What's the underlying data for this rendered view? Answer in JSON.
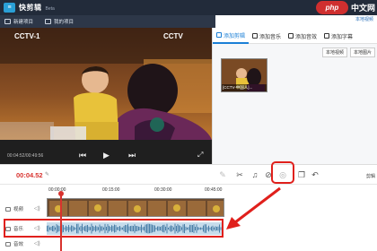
{
  "app": {
    "logo_glyph": "≡",
    "name": "快剪辑",
    "beta": "Beta"
  },
  "brand": {
    "badge": "php",
    "text": "中文网",
    "sub": "本地视频"
  },
  "toolbar": {
    "new_project": "新建项目",
    "my_projects": "我的项目"
  },
  "preview": {
    "time": "00:04:52/00:49:56",
    "prev_glyph": "⏮",
    "play_glyph": "▶",
    "next_glyph": "⏭",
    "fullscreen_glyph": "⤢"
  },
  "right_panel": {
    "tabs": [
      {
        "label": "添加剪辑",
        "active": true
      },
      {
        "label": "添加音乐",
        "active": false
      },
      {
        "label": "添加音效",
        "active": false
      },
      {
        "label": "添加字幕",
        "active": false
      }
    ],
    "import_local_video": "本地视频",
    "import_local_image": "本地图片",
    "clip_caption": "[CCTV-中国人]..."
  },
  "timeline": {
    "current_time": "00:04.52",
    "edit_glyph": "✎",
    "right_label": "剪辑",
    "ruler_labels": [
      "00:00:00",
      "00:15:00",
      "00:30:00",
      "00:45:00"
    ],
    "tools": {
      "pen": "✎",
      "cut": "✂",
      "bell": "♫",
      "shield": "⊘",
      "nodeselect": "◎",
      "copy": "❐",
      "undo": "↶"
    },
    "tracks": {
      "video": "视频",
      "audio": "音乐",
      "sfx": "音效",
      "volume_glyph": "◁)"
    }
  },
  "colors": {
    "accent_red": "#e0201c",
    "tab_blue": "#1a7fd6",
    "current_time_red": "#d8322e"
  }
}
